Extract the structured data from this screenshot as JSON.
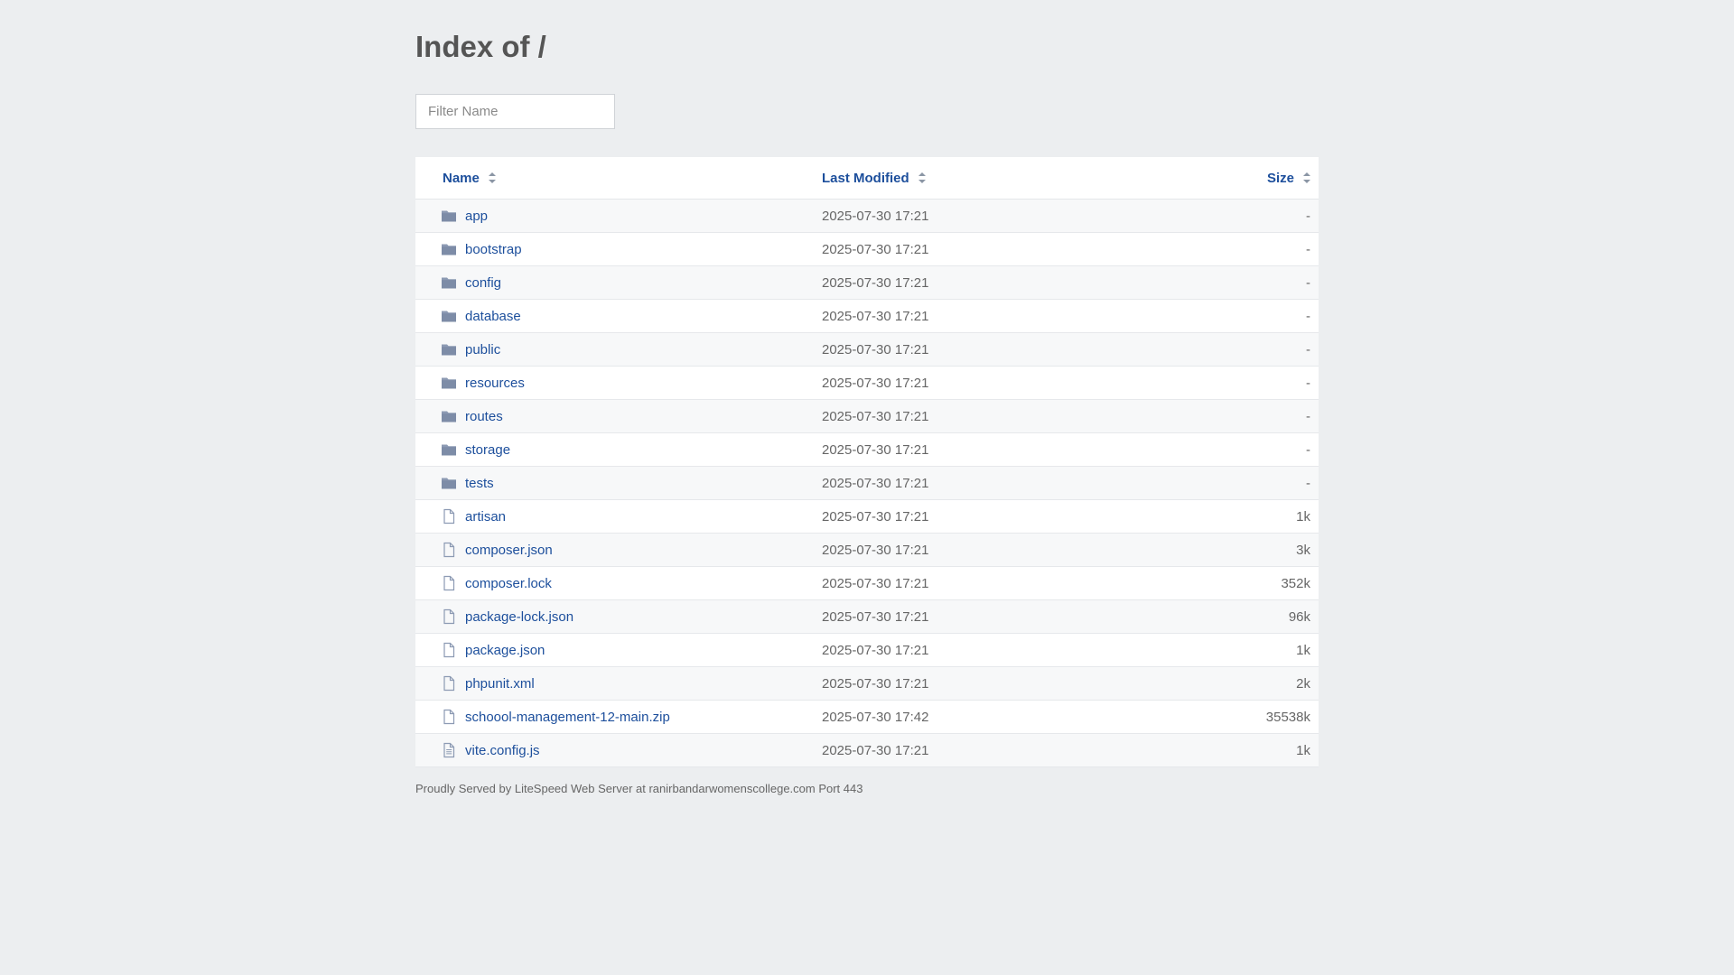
{
  "page": {
    "title": "Index of /",
    "filter_placeholder": "Filter Name"
  },
  "table": {
    "columns": {
      "name": "Name",
      "modified": "Last Modified",
      "size": "Size"
    },
    "rows": [
      {
        "name": "app",
        "modified": "2025-07-30 17:21",
        "size": "-",
        "type": "folder-icon"
      },
      {
        "name": "bootstrap",
        "modified": "2025-07-30 17:21",
        "size": "-",
        "type": "folder-icon"
      },
      {
        "name": "config",
        "modified": "2025-07-30 17:21",
        "size": "-",
        "type": "folder-icon"
      },
      {
        "name": "database",
        "modified": "2025-07-30 17:21",
        "size": "-",
        "type": "folder-icon"
      },
      {
        "name": "public",
        "modified": "2025-07-30 17:21",
        "size": "-",
        "type": "folder-icon"
      },
      {
        "name": "resources",
        "modified": "2025-07-30 17:21",
        "size": "-",
        "type": "folder-icon"
      },
      {
        "name": "routes",
        "modified": "2025-07-30 17:21",
        "size": "-",
        "type": "folder-icon"
      },
      {
        "name": "storage",
        "modified": "2025-07-30 17:21",
        "size": "-",
        "type": "folder-icon"
      },
      {
        "name": "tests",
        "modified": "2025-07-30 17:21",
        "size": "-",
        "type": "folder-icon"
      },
      {
        "name": "artisan",
        "modified": "2025-07-30 17:21",
        "size": "1k",
        "type": "file-icon"
      },
      {
        "name": "composer.json",
        "modified": "2025-07-30 17:21",
        "size": "3k",
        "type": "file-icon"
      },
      {
        "name": "composer.lock",
        "modified": "2025-07-30 17:21",
        "size": "352k",
        "type": "file-icon"
      },
      {
        "name": "package-lock.json",
        "modified": "2025-07-30 17:21",
        "size": "96k",
        "type": "file-icon"
      },
      {
        "name": "package.json",
        "modified": "2025-07-30 17:21",
        "size": "1k",
        "type": "file-icon"
      },
      {
        "name": "phpunit.xml",
        "modified": "2025-07-30 17:21",
        "size": "2k",
        "type": "file-icon"
      },
      {
        "name": "schoool-management-12-main.zip",
        "modified": "2025-07-30 17:42",
        "size": "35538k",
        "type": "file-icon"
      },
      {
        "name": "vite.config.js",
        "modified": "2025-07-30 17:21",
        "size": "1k",
        "type": "text-file-icon"
      }
    ]
  },
  "footer": {
    "text": "Proudly Served by LiteSpeed Web Server at ranirbandarwomenscollege.com Port 443"
  },
  "colors": {
    "link": "#1d4f9c",
    "background": "#eceef0",
    "folder_icon": "#8c9ab3"
  }
}
